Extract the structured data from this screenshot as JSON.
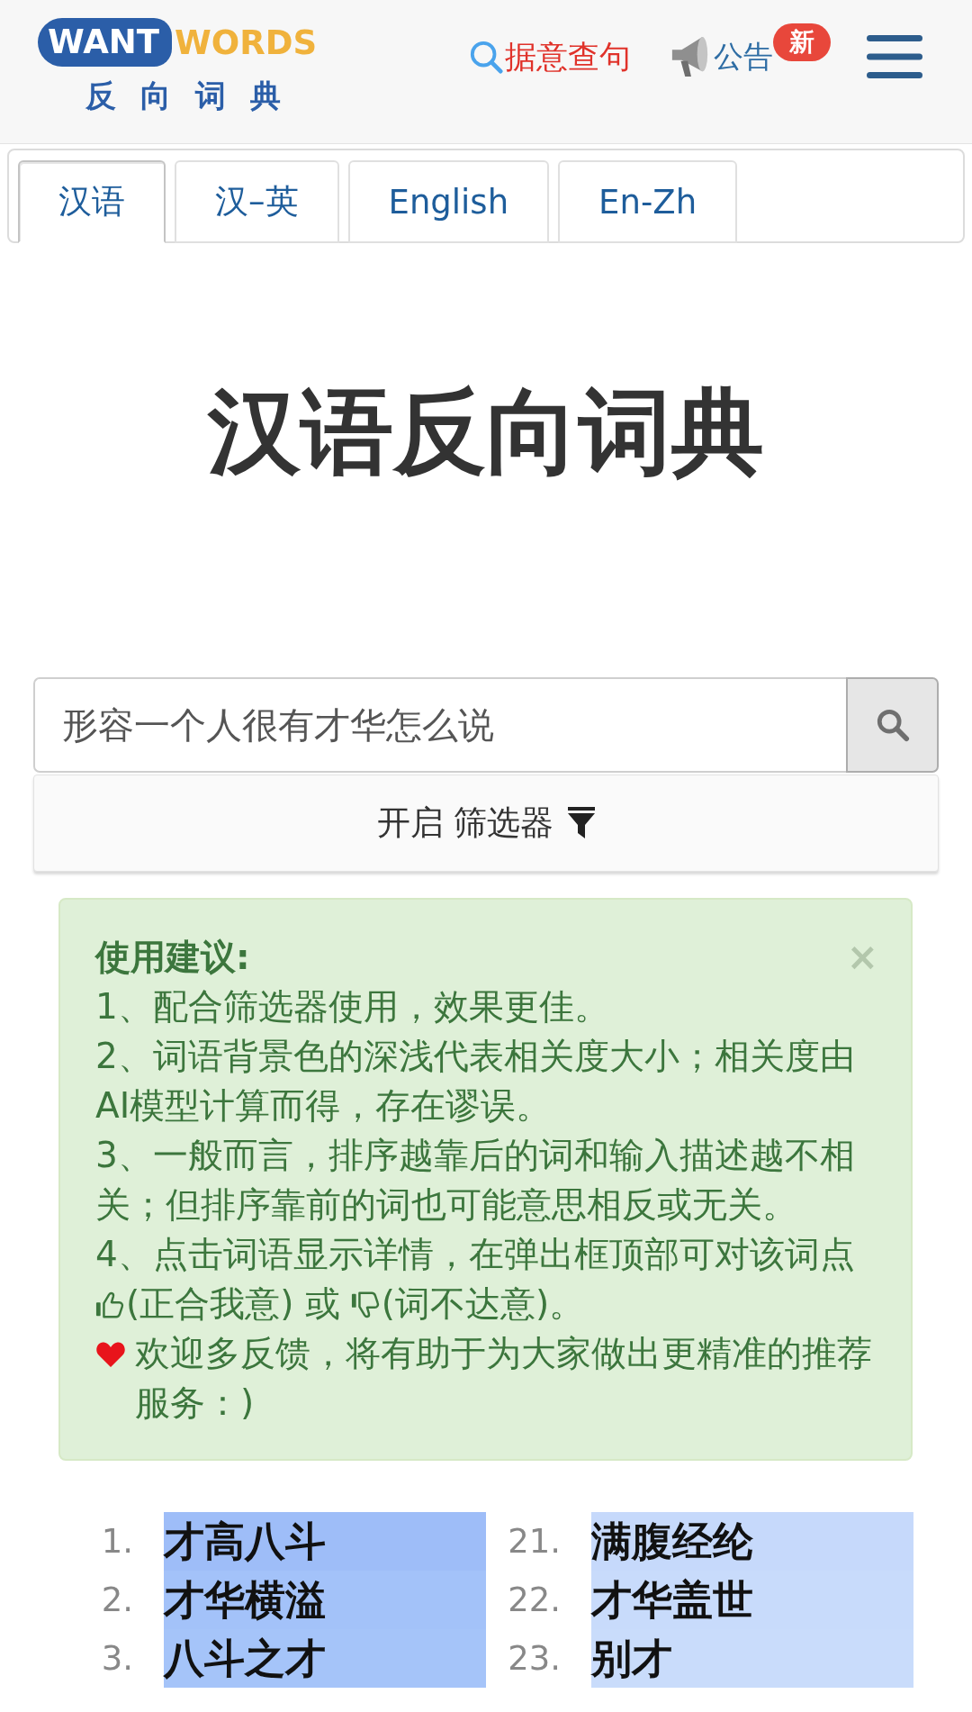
{
  "header": {
    "logo": {
      "badge": "WANT",
      "wordmark": "WORDS",
      "subtitle": "反向词典"
    },
    "links": [
      {
        "kind": "search",
        "label": "据意查句"
      },
      {
        "kind": "notice",
        "label": "公告",
        "badge": "新"
      }
    ]
  },
  "tabs": [
    {
      "label": "汉语",
      "selected": true
    },
    {
      "label": "汉–英",
      "selected": false
    },
    {
      "label": "English",
      "selected": false
    },
    {
      "label": "En-Zh",
      "selected": false
    }
  ],
  "title": "汉语反向词典",
  "search": {
    "value": "形容一个人很有才华怎么说"
  },
  "filter": {
    "label": "开启 筛选器"
  },
  "tips": {
    "title": "使用建议:",
    "close": "×",
    "items": [
      {
        "kind": "plain",
        "text": "1、配合筛选器使用，效果更佳。"
      },
      {
        "kind": "plain",
        "text": "2、词语背景色的深浅代表相关度大小；相关度由AI模型计算而得，存在谬误。"
      },
      {
        "kind": "plain",
        "text": "3、一般而言，排序越靠后的词和输入描述越不相关；但排序靠前的词也可能意思相反或无关。"
      },
      {
        "kind": "rating",
        "text": "4、点击词语显示详情，在弹出框顶部可对该词点",
        "like_text": "(正合我意) 或",
        "dislike_text": "(词不达意)。"
      },
      {
        "kind": "feedback",
        "text": "欢迎多反馈，将有助于为大家做出更精准的推荐服务：)"
      }
    ]
  },
  "results": {
    "columns": [
      {
        "items": [
          {
            "rank": "1.",
            "word": "才高八斗",
            "color": "#9ebdf8"
          },
          {
            "rank": "2.",
            "word": "才华横溢",
            "color": "#a3c2f9"
          },
          {
            "rank": "3.",
            "word": "八斗之才",
            "color": "#a5c4f9"
          }
        ]
      },
      {
        "items": [
          {
            "rank": "21.",
            "word": "满腹经纶",
            "color": "#c6d9fb"
          },
          {
            "rank": "22.",
            "word": "才华盖世",
            "color": "#c8dbfb"
          },
          {
            "rank": "23.",
            "word": "别才",
            "color": "#c9dcfb"
          }
        ]
      }
    ]
  }
}
